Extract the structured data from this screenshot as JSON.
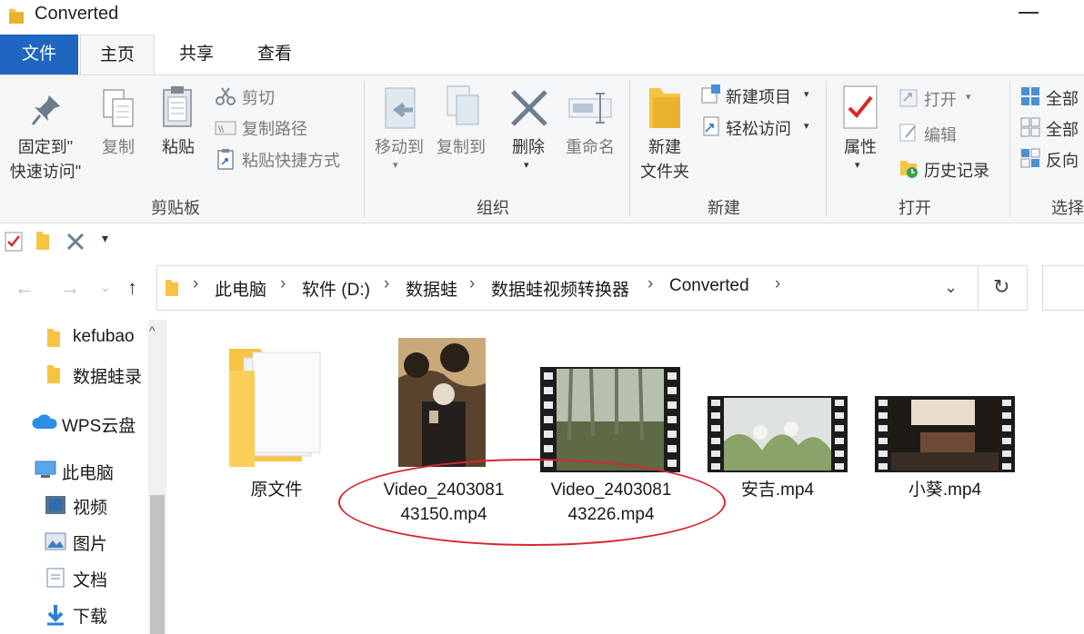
{
  "window": {
    "title": "Converted"
  },
  "ribbon_tabs": {
    "file": "文件",
    "home": "主页",
    "share": "共享",
    "view": "查看"
  },
  "ribbon": {
    "clipboard": {
      "pin_label_1": "固定到\"",
      "pin_label_2": "快速访问\"",
      "copy": "复制",
      "paste": "粘贴",
      "cut": "剪切",
      "copy_path": "复制路径",
      "paste_shortcut": "粘贴快捷方式",
      "group": "剪贴板"
    },
    "organize": {
      "move_to": "移动到",
      "copy_to": "复制到",
      "delete": "删除",
      "rename": "重命名",
      "group": "组织"
    },
    "new": {
      "new_folder_1": "新建",
      "new_folder_2": "文件夹",
      "new_item": "新建项目",
      "easy_access": "轻松访问",
      "group": "新建"
    },
    "open": {
      "properties": "属性",
      "open": "打开",
      "edit": "编辑",
      "history": "历史记录",
      "group": "打开"
    },
    "select": {
      "select_all": "全部",
      "select_none": "全部",
      "invert": "反向",
      "group": "选择"
    }
  },
  "address": {
    "crumbs": [
      "此电脑",
      "软件 (D:)",
      "数据蛙",
      "数据蛙视频转换器",
      "Converted"
    ]
  },
  "nav_pane": {
    "items": [
      "kefubao",
      "数据蛙录",
      "WPS云盘",
      "此电脑",
      "视频",
      "图片",
      "文档",
      "下载"
    ]
  },
  "files": [
    {
      "name": "原文件",
      "type": "folder"
    },
    {
      "name_line1": "Video_2403081",
      "name_line2": "43150.mp4",
      "type": "video"
    },
    {
      "name_line1": "Video_2403081",
      "name_line2": "43226.mp4",
      "type": "video"
    },
    {
      "name": "安吉.mp4",
      "type": "video"
    },
    {
      "name": "小葵.mp4",
      "type": "video"
    }
  ],
  "colors": {
    "accent": "#1e66c0",
    "highlight": "#d7262b",
    "folder": "#f6c343"
  }
}
